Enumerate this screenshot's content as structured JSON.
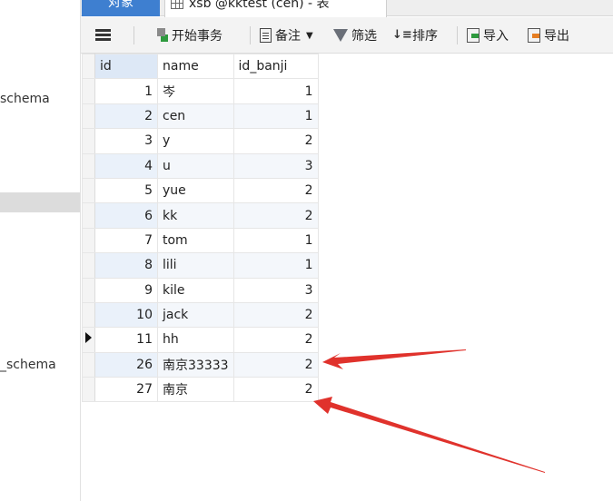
{
  "left_panel": {
    "items": [
      "schema",
      "_schema"
    ]
  },
  "tabs": {
    "objects_label": "对象",
    "table_tab_label": "xsb @kktest (cen) - 表"
  },
  "toolbar": {
    "menu_icon": "hamburger-menu-icon",
    "begin_transaction": "开始事务",
    "memo": "备注",
    "filter": "筛选",
    "sort": "排序",
    "import": "导入",
    "export": "导出"
  },
  "grid": {
    "columns": [
      "id",
      "name",
      "id_banji"
    ],
    "rows": [
      {
        "id": "1",
        "name": "岑",
        "id_banji": "1"
      },
      {
        "id": "2",
        "name": "cen",
        "id_banji": "1"
      },
      {
        "id": "3",
        "name": "y",
        "id_banji": "2"
      },
      {
        "id": "4",
        "name": "u",
        "id_banji": "3"
      },
      {
        "id": "5",
        "name": "yue",
        "id_banji": "2"
      },
      {
        "id": "6",
        "name": "kk",
        "id_banji": "2"
      },
      {
        "id": "7",
        "name": "tom",
        "id_banji": "1"
      },
      {
        "id": "8",
        "name": "lili",
        "id_banji": "1"
      },
      {
        "id": "9",
        "name": "kile",
        "id_banji": "3"
      },
      {
        "id": "10",
        "name": "jack",
        "id_banji": "2"
      },
      {
        "id": "11",
        "name": "hh",
        "id_banji": "2"
      },
      {
        "id": "26",
        "name": "南京33333",
        "id_banji": "2"
      },
      {
        "id": "27",
        "name": "南京",
        "id_banji": "2"
      }
    ],
    "current_row_index": 10
  },
  "annotation_color": "#e0322c"
}
